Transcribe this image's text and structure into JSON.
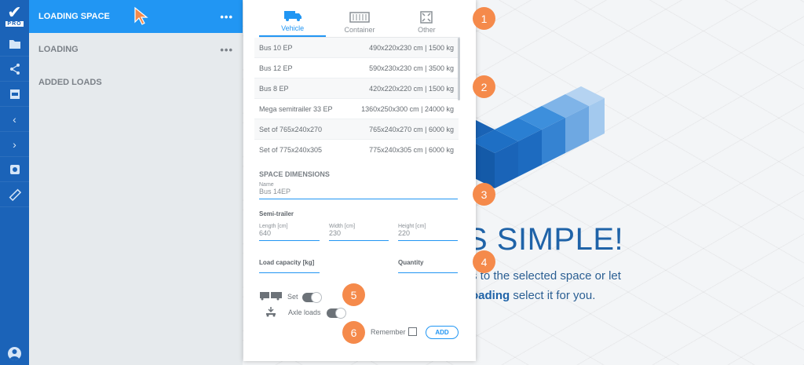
{
  "app": {
    "logo_text": "PRO"
  },
  "sidebar": {
    "items": [
      {
        "label": "LOADING SPACE",
        "active": true,
        "more": "•••"
      },
      {
        "label": "LOADING",
        "active": false,
        "more": "•••"
      },
      {
        "label": "ADDED LOADS",
        "active": false,
        "more": ""
      }
    ]
  },
  "tabs": [
    {
      "label": "Vehicle",
      "icon": "truck-icon",
      "active": true
    },
    {
      "label": "Container",
      "icon": "container-icon",
      "active": false
    },
    {
      "label": "Other",
      "icon": "expand-icon",
      "active": false
    }
  ],
  "vehicles": [
    {
      "name": "Bus 10 EP",
      "spec": "490x220x230 cm | 1500 kg"
    },
    {
      "name": "Bus 12 EP",
      "spec": "590x230x230 cm | 3500 kg"
    },
    {
      "name": "Bus 8 EP",
      "spec": "420x220x220 cm | 1500 kg"
    },
    {
      "name": "Mega semitrailer 33 EP",
      "spec": "1360x250x300 cm | 24000 kg"
    },
    {
      "name": "Set of 765x240x270",
      "spec": "765x240x270 cm | 6000 kg"
    },
    {
      "name": "Set of 775x240x305",
      "spec": "775x240x305 cm | 6000 kg"
    }
  ],
  "space": {
    "section_title": "SPACE DIMENSIONS",
    "name_label": "Name",
    "name_value": "Bus 14EP",
    "semi_trailer_label": "Semi-trailer",
    "length_label": "Length [cm]",
    "length_value": "640",
    "width_label": "Width [cm]",
    "width_value": "230",
    "height_label": "Height [cm]",
    "height_value": "220",
    "capacity_label": "Load capacity [kg]",
    "quantity_label": "Quantity"
  },
  "options": {
    "set_label": "Set",
    "axle_label": "Axle loads",
    "remember_label": "Remember",
    "add_label": "ADD"
  },
  "badges": [
    "1",
    "2",
    "3",
    "4",
    "5",
    "6"
  ],
  "background": {
    "headline": "S SIMPLE!",
    "line1": "s to the selected space or let",
    "line2_bold": "oading",
    "line2_rest": " select it for you."
  },
  "colors": {
    "accent": "#2196f3",
    "rail": "#1b63b8",
    "badge": "#f58a4b"
  }
}
